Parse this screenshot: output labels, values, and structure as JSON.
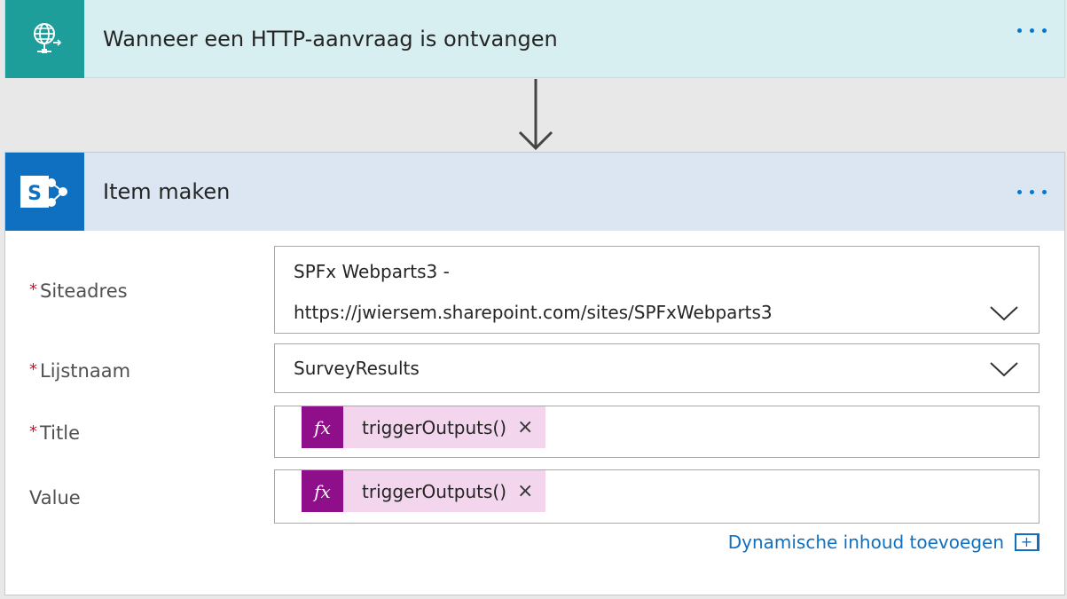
{
  "trigger": {
    "title": "Wanneer een HTTP-aanvraag is ontvangen",
    "icon": "http-request-icon",
    "accent": "#1e9e9a"
  },
  "action": {
    "title": "Item maken",
    "icon": "sharepoint-icon",
    "accent": "#0f6fc1",
    "fields": {
      "site": {
        "label": "Siteadres",
        "required": "*",
        "value_line1": "SPFx Webparts3 -",
        "value_line2": "https://jwiersem.sharepoint.com/sites/SPFxWebparts3"
      },
      "list": {
        "label": "Lijstnaam",
        "required": "*",
        "value": "SurveyResults"
      },
      "title": {
        "label": "Title",
        "required": "*",
        "token": "triggerOutputs()",
        "token_icon": "fx"
      },
      "value": {
        "label": "Value",
        "token": "triggerOutputs()",
        "token_icon": "fx"
      }
    },
    "dynamic_content_link": "Dynamische inhoud toevoegen",
    "dynamic_content_icon": "+"
  }
}
